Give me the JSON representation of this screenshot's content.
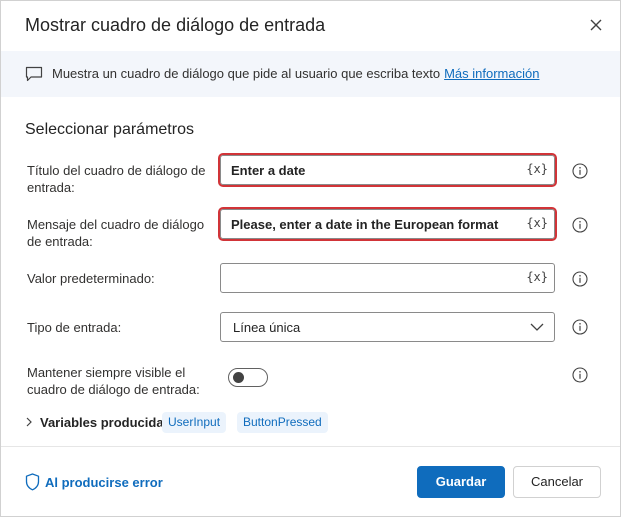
{
  "dialog": {
    "title": "Mostrar cuadro de diálogo de entrada",
    "close_icon": "close-icon"
  },
  "infobar": {
    "icon": "message-icon",
    "text": "Muestra un cuadro de diálogo que pide al usuario que escriba texto",
    "link": "Más información"
  },
  "section_title": "Seleccionar parámetros",
  "params": {
    "title": {
      "label": "Título del cuadro de diálogo de entrada:",
      "value": "Enter a date",
      "var_button": "{x}"
    },
    "message": {
      "label": "Mensaje del cuadro de diálogo de entrada:",
      "value": "Please, enter a date in the European format",
      "var_button": "{x}"
    },
    "default_value": {
      "label": "Valor predeterminado:",
      "value": "",
      "var_button": "{x}"
    },
    "input_type": {
      "label": "Tipo de entrada:",
      "selected": "Línea única"
    },
    "keep_visible": {
      "label": "Mantener siempre visible el cuadro de diálogo de entrada:",
      "enabled": false
    }
  },
  "variables": {
    "label": "Variables producidas",
    "items": [
      "UserInput",
      "ButtonPressed"
    ]
  },
  "footer": {
    "error_label": "Al producirse error",
    "save_label": "Guardar",
    "cancel_label": "Cancelar"
  },
  "colors": {
    "accent": "#0f6cbd",
    "highlight": "#d13438",
    "infobar_bg": "#f3f6fb"
  }
}
